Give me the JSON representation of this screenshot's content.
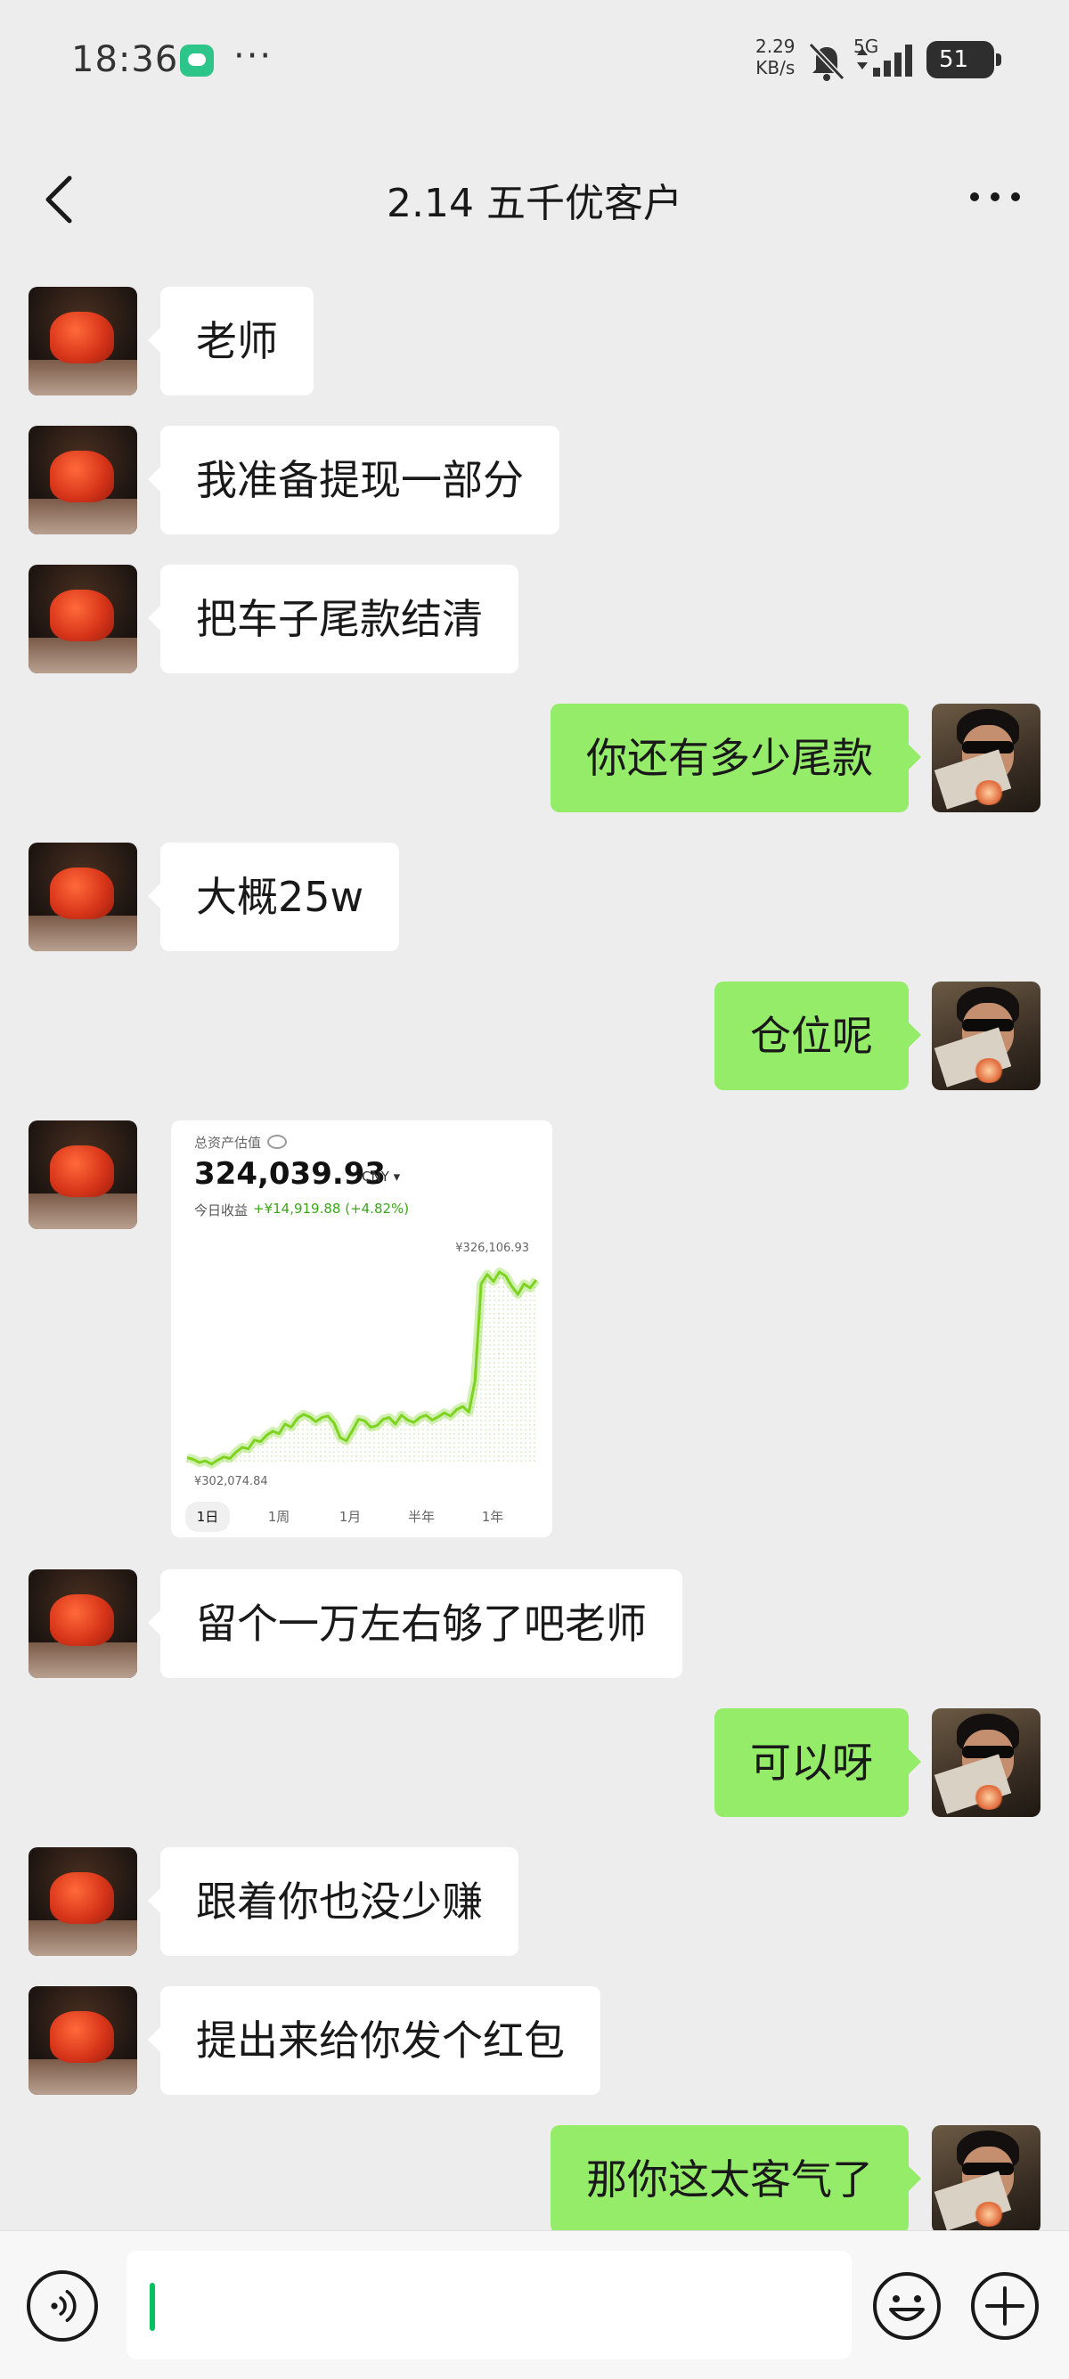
{
  "status": {
    "time": "18:36",
    "more": "···",
    "speed_value": "2.29",
    "speed_unit": "KB/s",
    "network": "5G",
    "battery": "51"
  },
  "header": {
    "title": "2.14 五千优客户"
  },
  "messages": [
    {
      "side": "left",
      "text": "老师"
    },
    {
      "side": "left",
      "text": "我准备提现一部分"
    },
    {
      "side": "left",
      "text": "把车子尾款结清"
    },
    {
      "side": "right",
      "text": "你还有多少尾款"
    },
    {
      "side": "left",
      "text": "大概25w"
    },
    {
      "side": "right",
      "text": "仓位呢"
    },
    {
      "side": "left",
      "type": "image"
    },
    {
      "side": "left",
      "text": "留个一万左右够了吧老师"
    },
    {
      "side": "right",
      "text": "可以呀"
    },
    {
      "side": "left",
      "text": "跟着你也没少赚"
    },
    {
      "side": "left",
      "text": "提出来给你发个红包"
    },
    {
      "side": "right",
      "text": "那你这太客气了"
    }
  ],
  "image_card": {
    "label": "总资产估值",
    "value": "324,039.93",
    "currency": "CNY ▾",
    "today_label": "今日收益",
    "today_gain": "+¥14,919.88 (+4.82%)",
    "max_label": "¥326,106.93",
    "min_label": "¥302,074.84",
    "tabs": [
      "1日",
      "1周",
      "1月",
      "半年",
      "1年"
    ],
    "line_color": "#7ed321"
  },
  "chart_data": {
    "type": "line",
    "title": "",
    "xlabel": "",
    "ylabel": "",
    "ylim": [
      302074.84,
      326106.93
    ],
    "values": [
      302900,
      302700,
      302300,
      302500,
      302100,
      302600,
      303000,
      302800,
      303600,
      304200,
      304000,
      305100,
      304900,
      305700,
      306200,
      305900,
      307100,
      306700,
      307800,
      308300,
      308000,
      307400,
      307900,
      308100,
      307200,
      305400,
      305000,
      306300,
      307700,
      307500,
      306700,
      306900,
      307700,
      307900,
      307100,
      308200,
      307600,
      307300,
      307900,
      308200,
      307600,
      308000,
      308500,
      308100,
      308900,
      309300,
      308600,
      312500,
      324600,
      325800,
      324900,
      326100,
      325600,
      324300,
      323300,
      324600,
      324100,
      325100
    ]
  },
  "input": {
    "placeholder": ""
  },
  "colors": {
    "background": "#ededed",
    "bubble_self": "#95ec69",
    "bubble_other": "#ffffff",
    "caret": "#07c160"
  }
}
